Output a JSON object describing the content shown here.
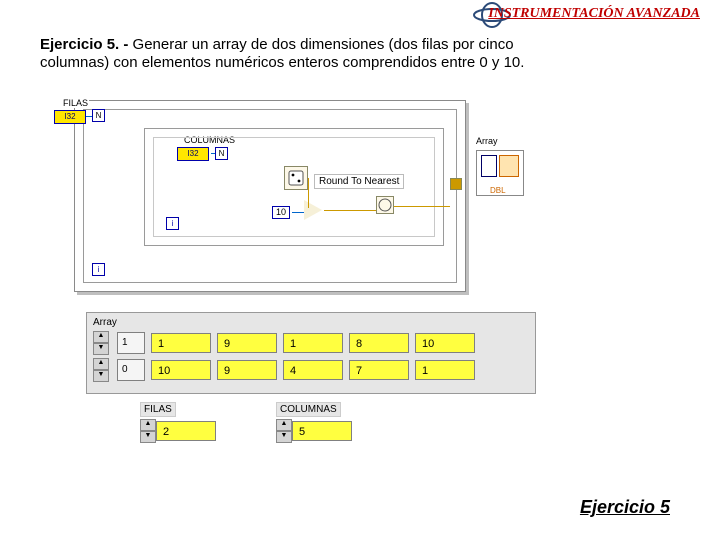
{
  "header": {
    "title": "INSTRUMENTACIÓN AVANZADA"
  },
  "exercise": {
    "text_bold": "Ejercicio 5. -",
    "text": " Generar un array de dos dimensiones (dos filas por cinco columnas) con elementos numéricos enteros comprendidos entre 0 y 10."
  },
  "diagram": {
    "filas_label": "FILAS",
    "columnas_label": "COLUMNAS",
    "filas_ctrl": "I32",
    "columnas_ctrl": "I32",
    "n_symbol": "N",
    "i_symbol": "i",
    "constant10": "10",
    "round_label": "Round To Nearest",
    "array_label": "Array",
    "array_db": "DBL"
  },
  "front_panel": {
    "title": "Array",
    "rows": [
      {
        "index": "1",
        "cells": [
          "1",
          "9",
          "1",
          "8",
          "10"
        ]
      },
      {
        "index": "0",
        "cells": [
          "10",
          "9",
          "4",
          "7",
          "1"
        ]
      }
    ]
  },
  "controls": {
    "filas": {
      "label": "FILAS",
      "value": "2"
    },
    "columnas": {
      "label": "COLUMNAS",
      "value": "5"
    }
  },
  "footer": {
    "link": "Ejercicio 5"
  }
}
